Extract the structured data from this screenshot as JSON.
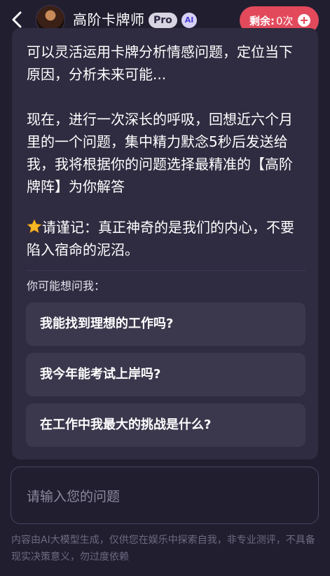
{
  "header": {
    "title": "高阶卡牌师",
    "pro_badge": "Pro",
    "ai_badge": "AI",
    "remain_label": "剩余:",
    "remain_value": "0次"
  },
  "message": {
    "paragraph1": "可以灵活运用卡牌分析情感问题，定位当下原因，分析未来可能...",
    "paragraph2": "现在，进行一次深长的呼吸，回想近六个月里的一个问题，集中精力默念5秒后发送给我，我将根据你的问题选择最精准的【高阶牌阵】为你解答",
    "paragraph3": "请谨记：真正神奇的是我们的内心，不要陷入宿命的泥沼。"
  },
  "suggestions": {
    "hint": "你可能想问我：",
    "items": [
      "我能找到理想的工作吗?",
      "我今年能考试上岸吗?",
      "在工作中我最大的挑战是什么?"
    ]
  },
  "input": {
    "placeholder": "请输入您的问题"
  },
  "footer": {
    "disclaimer": "内容由AI大模型生成，仅供您在娱乐中探索自我，非专业测评，不具备现实决策意义，勿过度依赖"
  },
  "colors": {
    "background": "#211e30",
    "card": "#2f2b40",
    "suggestion": "#3b374c",
    "remain_button": "#e24a5c",
    "star": "#f7b825"
  },
  "icons": {
    "back": "chevron-left-icon",
    "remain_add": "plus-circle-icon",
    "star": "star-icon"
  }
}
